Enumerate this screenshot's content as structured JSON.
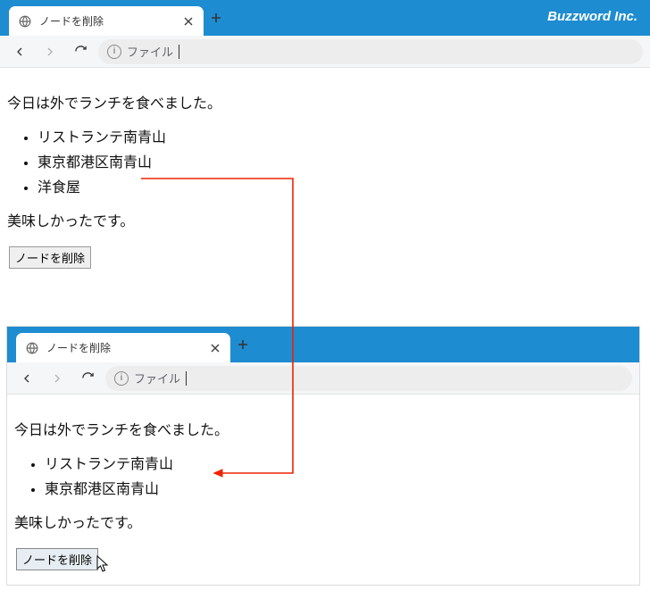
{
  "brand": "Buzzword Inc.",
  "window1": {
    "tab_title": "ノードを削除",
    "addr_label": "ファイル",
    "page": {
      "intro": "今日は外でランチを食べました。",
      "items": [
        "リストランテ南青山",
        "東京都港区南青山",
        "洋食屋"
      ],
      "outro": "美味しかったです。",
      "button": "ノードを削除"
    }
  },
  "window2": {
    "tab_title": "ノードを削除",
    "addr_label": "ファイル",
    "page": {
      "intro": "今日は外でランチを食べました。",
      "items": [
        "リストランテ南青山",
        "東京都港区南青山"
      ],
      "outro": "美味しかったです。",
      "button": "ノードを削除"
    }
  }
}
